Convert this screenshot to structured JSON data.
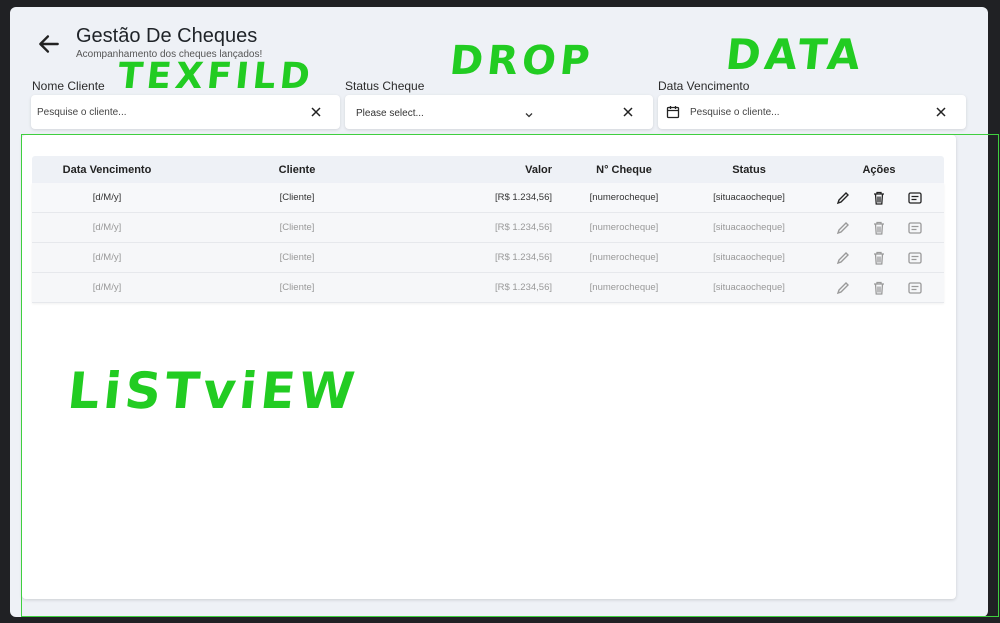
{
  "header": {
    "title": "Gestão De Cheques",
    "subtitle": "Acompanhamento dos cheques lançados!"
  },
  "filters": {
    "cliente": {
      "label": "Nome Cliente",
      "placeholder": "Pesquise o cliente..."
    },
    "status": {
      "label": "Status Cheque",
      "value": "Please select..."
    },
    "vencimento": {
      "label": "Data Vencimento",
      "placeholder": "Pesquise o cliente..."
    }
  },
  "table": {
    "columns": [
      "Data Vencimento",
      "Cliente",
      "Valor",
      "N° Cheque",
      "Status",
      "Ações"
    ],
    "rows": [
      [
        "[d/M/y]",
        "[Cliente]",
        "[R$ 1.234,56]",
        "[numerocheque]",
        "[situacaocheque]"
      ],
      [
        "[d/M/y]",
        "[Cliente]",
        "[R$ 1.234,56]",
        "[numerocheque]",
        "[situacaocheque]"
      ],
      [
        "[d/M/y]",
        "[Cliente]",
        "[R$ 1.234,56]",
        "[numerocheque]",
        "[situacaocheque]"
      ],
      [
        "[d/M/y]",
        "[Cliente]",
        "[R$ 1.234,56]",
        "[numerocheque]",
        "[situacaocheque]"
      ]
    ]
  },
  "annotations": {
    "textfield": "TEXFILD",
    "dropdown": "DROP",
    "date": "DATA",
    "listview": "LiSTviEW"
  },
  "colors": {
    "annotation": "#22cc22",
    "background": "#eef1f6",
    "dark": "#202124"
  },
  "icons": [
    "back-arrow-icon",
    "close-icon",
    "chevron-down-icon",
    "calendar-icon",
    "edit-icon",
    "delete-icon",
    "details-icon"
  ]
}
